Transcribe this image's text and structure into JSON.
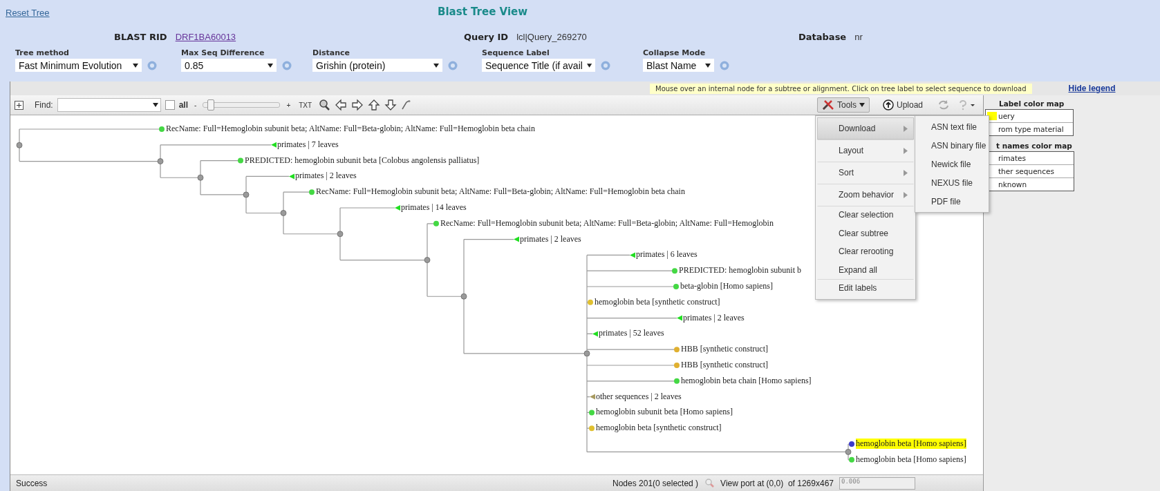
{
  "header": {
    "reset_link": "Reset Tree",
    "title": "Blast Tree View",
    "info": [
      {
        "label": "BLAST RID",
        "value": "DRF1BA60013",
        "kind": "link"
      },
      {
        "label": "Query ID",
        "value": "lcl|Query_269270",
        "kind": "text"
      },
      {
        "label": "Database",
        "value": "nr",
        "kind": "text"
      }
    ]
  },
  "settings": [
    {
      "label": "Tree method",
      "value": "Fast Minimum Evolution"
    },
    {
      "label": "Max Seq Difference",
      "value": "0.85"
    },
    {
      "label": "Distance",
      "value": "Grishin (protein)"
    },
    {
      "label": "Sequence Label",
      "value": "Sequence Title (if avail"
    },
    {
      "label": "Collapse Mode",
      "value": "Blast Name"
    }
  ],
  "hint": "Mouse over an internal node for a subtree or alignment. Click on tree label to select sequence to download",
  "hide_legend": "Hide legend",
  "toolbar": {
    "find_label": "Find:",
    "all_label": "all",
    "all_checked": false,
    "zoom_out": "-",
    "zoom_in": "+",
    "zoom_slider": {
      "level": 0.05
    },
    "txt": "TXT",
    "tools": "Tools",
    "tools_open": true,
    "upload": "Upload"
  },
  "tools_menu": [
    {
      "label": "Download",
      "has_submenu": true,
      "selected": true
    },
    {
      "label": "Layout",
      "has_submenu": true,
      "selected": false
    },
    {
      "label": "Sort",
      "has_submenu": true,
      "selected": false
    },
    {
      "label": "Zoom behavior",
      "has_submenu": true,
      "selected": false
    },
    {
      "label": "Clear selection",
      "has_submenu": false,
      "selected": false
    },
    {
      "label": "Clear subtree",
      "has_submenu": false,
      "selected": false
    },
    {
      "label": "Clear rerooting",
      "has_submenu": false,
      "selected": false
    },
    {
      "label": "Expand all",
      "has_submenu": false,
      "selected": false
    },
    {
      "label": "Edit labels",
      "has_submenu": false,
      "selected": false
    }
  ],
  "download_submenu": [
    "ASN text file",
    "ASN binary file",
    "Newick file",
    "NEXUS file",
    "PDF file"
  ],
  "legend": {
    "label_title": "Label color map",
    "label_rows": [
      {
        "label": "uery",
        "color": "#ffff00"
      },
      {
        "label": "rom type material"
      }
    ],
    "names_title": "t names color map",
    "names_rows": [
      {
        "label": "rimates"
      },
      {
        "label": "ther sequences"
      },
      {
        "label": "nknown"
      }
    ]
  },
  "tree": {
    "children": [
      {
        "kind": "sequence",
        "label": "RecName: Full=Hemoglobin subunit beta; AltName: Full=Beta-globin; AltName: Full=Hemoglobin beta chain",
        "color": "#44d844",
        "highlighted": false
      },
      {
        "children": [
          {
            "kind": "collapsed",
            "label": "primates | 7 leaves",
            "color": "#22dd22",
            "highlighted": false
          },
          {
            "children": [
              {
                "kind": "sequence",
                "label": "PREDICTED: hemoglobin subunit beta [Colobus angolensis palliatus]",
                "color": "#44d844",
                "highlighted": false
              },
              {
                "children": [
                  {
                    "kind": "collapsed",
                    "label": "primates | 2 leaves",
                    "color": "#22dd22",
                    "highlighted": false
                  },
                  {
                    "children": [
                      {
                        "kind": "sequence",
                        "label": "RecName: Full=Hemoglobin subunit beta; AltName: Full=Beta-globin; AltName: Full=Hemoglobin beta chain",
                        "color": "#44d844",
                        "highlighted": false
                      },
                      {
                        "children": [
                          {
                            "kind": "collapsed",
                            "label": "primates | 14 leaves",
                            "color": "#22dd22",
                            "highlighted": false
                          },
                          {
                            "children": [
                              {
                                "kind": "sequence",
                                "label": "RecName: Full=Hemoglobin subunit beta; AltName: Full=Beta-globin; AltName: Full=Hemoglobin",
                                "color": "#44d844",
                                "highlighted": false
                              },
                              {
                                "children": [
                                  {
                                    "kind": "collapsed",
                                    "label": "primates | 2 leaves",
                                    "color": "#22dd22",
                                    "highlighted": false
                                  },
                                  {
                                    "children": [
                                      {
                                        "kind": "collapsed",
                                        "label": "primates | 6 leaves",
                                        "color": "#22dd22",
                                        "highlighted": false
                                      },
                                      {
                                        "kind": "sequence",
                                        "label": "PREDICTED: hemoglobin subunit b",
                                        "color": "#44d844",
                                        "highlighted": false
                                      },
                                      {
                                        "kind": "sequence",
                                        "label": "beta-globin [Homo sapiens]",
                                        "color": "#44d844",
                                        "highlighted": false
                                      },
                                      {
                                        "kind": "sequence",
                                        "label": "hemoglobin beta [synthetic construct]",
                                        "color": "#e0c030",
                                        "highlighted": false
                                      },
                                      {
                                        "kind": "collapsed",
                                        "label": "primates | 2 leaves",
                                        "color": "#22dd22",
                                        "highlighted": false
                                      },
                                      {
                                        "kind": "collapsed",
                                        "label": "primates | 52 leaves",
                                        "color": "#22dd22",
                                        "highlighted": false
                                      },
                                      {
                                        "kind": "sequence",
                                        "label": "HBB [synthetic construct]",
                                        "color": "#e0b030",
                                        "highlighted": false
                                      },
                                      {
                                        "kind": "sequence",
                                        "label": "HBB [synthetic construct]",
                                        "color": "#e0b030",
                                        "highlighted": false
                                      },
                                      {
                                        "kind": "sequence",
                                        "label": "hemoglobin beta chain [Homo sapiens]",
                                        "color": "#44d844",
                                        "highlighted": false
                                      },
                                      {
                                        "kind": "collapsed",
                                        "label": "other sequences | 2 leaves",
                                        "color": "#a89a60",
                                        "highlighted": false
                                      },
                                      {
                                        "kind": "sequence",
                                        "label": "hemoglobin subunit beta [Homo sapiens]",
                                        "color": "#44d844",
                                        "highlighted": false
                                      },
                                      {
                                        "kind": "sequence",
                                        "label": "hemoglobin beta [synthetic construct]",
                                        "color": "#e0c030",
                                        "highlighted": false
                                      },
                                      {
                                        "children": [
                                          {
                                            "kind": "sequence",
                                            "label": "hemoglobin beta [Homo sapiens]",
                                            "color": "#3a3acc",
                                            "highlighted": true
                                          },
                                          {
                                            "kind": "sequence",
                                            "label": "hemoglobin beta [Homo sapiens]",
                                            "color": "#44d844",
                                            "highlighted": false
                                          }
                                        ]
                                      }
                                    ]
                                  }
                                ]
                              }
                            ]
                          }
                        ]
                      }
                    ]
                  }
                ]
              }
            ]
          }
        ]
      }
    ]
  },
  "status": {
    "message": "Success",
    "nodes": "Nodes 201(0 selected )",
    "viewport": "View port at (0,0)  of 1269x467",
    "scale": "0.006"
  }
}
